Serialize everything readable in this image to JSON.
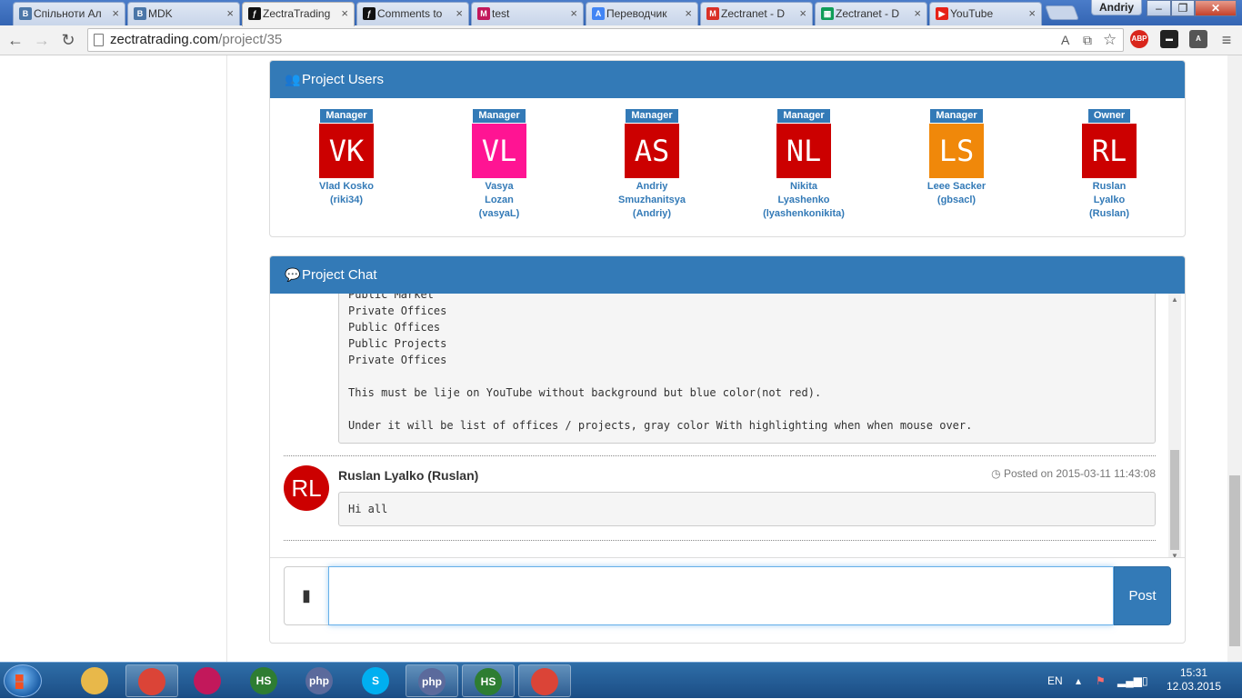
{
  "browser": {
    "tabs": [
      {
        "title": "Спільноти Ал",
        "favicon": "vk-icon",
        "color": "#4a76a8",
        "glyph": "B"
      },
      {
        "title": "MDK",
        "favicon": "vk-icon",
        "color": "#4a76a8",
        "glyph": "B"
      },
      {
        "title": "ZectraTrading",
        "favicon": "symfony-icon",
        "color": "#111111",
        "glyph": "ƒ"
      },
      {
        "title": "Comments to",
        "favicon": "symfony-icon",
        "color": "#111111",
        "glyph": "ƒ"
      },
      {
        "title": "test",
        "favicon": "app-icon",
        "color": "#c2185b",
        "glyph": "M"
      },
      {
        "title": "Переводчик",
        "favicon": "translate-icon",
        "color": "#4285f4",
        "glyph": "A"
      },
      {
        "title": "Zectranet - D",
        "favicon": "gmail-icon",
        "color": "#d93025",
        "glyph": "M"
      },
      {
        "title": "Zectranet - D",
        "favicon": "sheets-icon",
        "color": "#0f9d58",
        "glyph": "▦"
      },
      {
        "title": "YouTube",
        "favicon": "youtube-icon",
        "color": "#e62117",
        "glyph": "▶"
      }
    ],
    "user": "Andriy",
    "url_host": "zectratrading.com",
    "url_path": "/project/35"
  },
  "project_users": {
    "heading": "Project Users",
    "users": [
      {
        "role": "Manager",
        "initials": "VK",
        "color": "#cc0000",
        "name_lines": [
          "Vlad Kosko",
          "(riki34)"
        ]
      },
      {
        "role": "Manager",
        "initials": "VL",
        "color": "#ff1493",
        "name_lines": [
          "Vasya",
          "Lozan",
          "(vasyaL)"
        ]
      },
      {
        "role": "Manager",
        "initials": "AS",
        "color": "#cc0000",
        "name_lines": [
          "Andriy",
          "Smuzhanitsya",
          "(Andriy)"
        ]
      },
      {
        "role": "Manager",
        "initials": "NL",
        "color": "#cc0000",
        "name_lines": [
          "Nikita",
          "Lyashenko",
          "(lyashenkonikita)"
        ]
      },
      {
        "role": "Manager",
        "initials": "LS",
        "color": "#f0880a",
        "name_lines": [
          "Leee Sacker",
          "(gbsacl)"
        ]
      },
      {
        "role": "Owner",
        "initials": "RL",
        "color": "#cc0000",
        "name_lines": [
          "Ruslan",
          "Lyalko",
          "(Ruslan)"
        ]
      }
    ]
  },
  "project_chat": {
    "heading": "Project Chat",
    "previous_message_lines": [
      "Public Market",
      "Private Offices",
      "Public Offices",
      "Public Projects",
      "Private Offices",
      "",
      "This must be lije on YouTube without background but blue color(not red).",
      "",
      "Under it will be list of offices / projects, gray color With highlighting when when mouse over."
    ],
    "message": {
      "avatar_initials": "RL",
      "author": "Ruslan Lyalko (Ruslan)",
      "posted": "Posted on 2015-03-11 11:43:08",
      "text": "Hi all"
    },
    "input_value": "",
    "post_label": "Post"
  },
  "taskbar": {
    "items": [
      {
        "name": "file-explorer-icon",
        "label": "",
        "color": "#e8b84a"
      },
      {
        "name": "chrome-icon",
        "label": "",
        "color": "#db4437"
      },
      {
        "name": "app-icon",
        "label": "",
        "color": "#c2185b"
      },
      {
        "name": "heidisql-icon",
        "label": "HS",
        "color": "#2e7d32"
      },
      {
        "name": "php-icon",
        "label": "php",
        "color": "#5b6a9c"
      },
      {
        "name": "skype-icon",
        "label": "S",
        "color": "#00aff0"
      },
      {
        "name": "php-icon",
        "label": "php",
        "color": "#5b6a9c"
      },
      {
        "name": "heidisql-icon",
        "label": "HS",
        "color": "#2e7d32"
      },
      {
        "name": "chrome-icon",
        "label": "",
        "color": "#db4437"
      }
    ],
    "language": "EN",
    "time": "15:31",
    "date": "12.03.2015"
  }
}
